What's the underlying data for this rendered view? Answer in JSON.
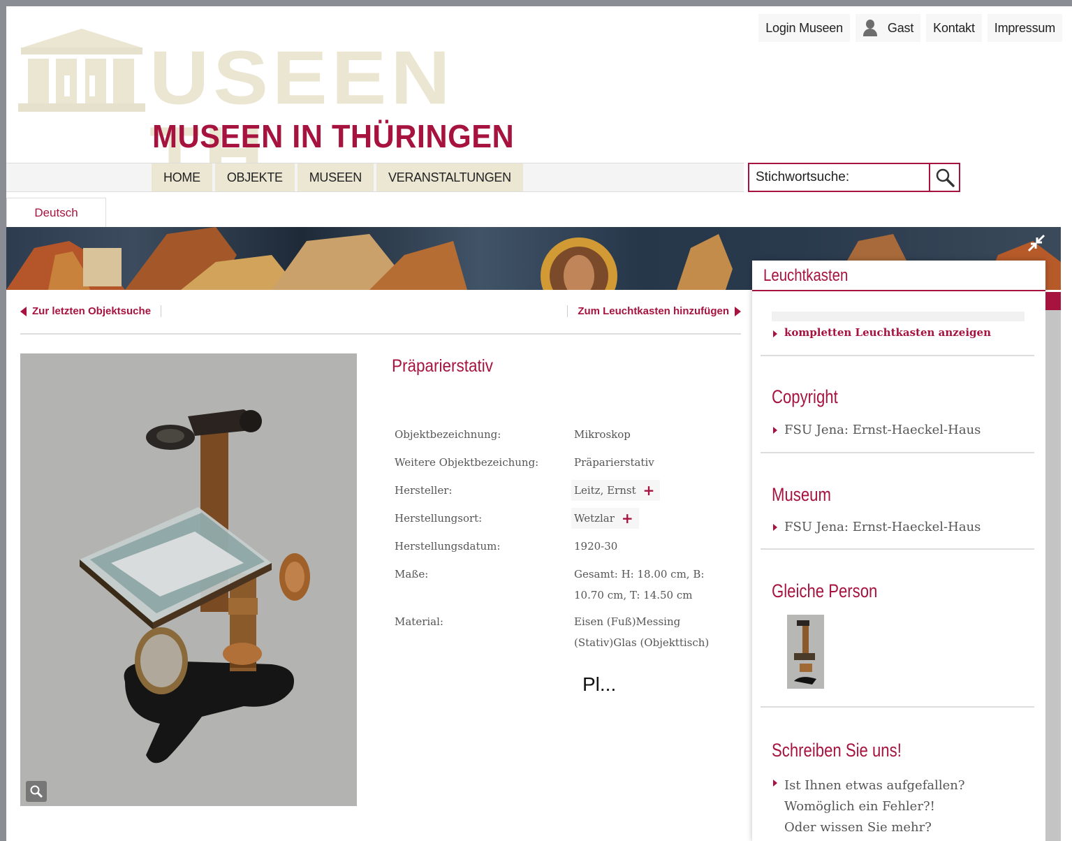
{
  "topnav": {
    "login": "Login Museen",
    "guest": "Gast",
    "contact": "Kontakt",
    "imprint": "Impressum"
  },
  "logo": {
    "big": "USEEN TH",
    "sub": "MUSEEN IN THÜRINGEN"
  },
  "nav": {
    "items": [
      "HOME",
      "OBJEKTE",
      "MUSEEN",
      "VERANSTALTUNGEN"
    ]
  },
  "search": {
    "placeholder": "Stichwortsuche:"
  },
  "lang": "Deutsch",
  "crumbs": {
    "back": "Zur letzten Objektsuche",
    "add": "Zum Leuchtkasten hinzufügen"
  },
  "object": {
    "title": "Präparierstativ",
    "fields": [
      {
        "label": "Objektbezeichnung:",
        "value": "Mikroskop"
      },
      {
        "label": "Weitere Objektbezeichung:",
        "value": "Präparierstativ"
      },
      {
        "label": "Hersteller:",
        "value": "Leitz, Ernst"
      },
      {
        "label": "Herstellungsort:",
        "value": "Wetzlar"
      },
      {
        "label": "Herstellungsdatum:",
        "value": "1920-30"
      },
      {
        "label": "Maße:",
        "value": "Gesamt: H: 18.00 cm, B: 10.70 cm, T: 14.50 cm"
      },
      {
        "label": "Material:",
        "value": "Eisen (Fuß)Messing (Stativ)Glas (Objekttisch)"
      }
    ],
    "truncated": "Pl..."
  },
  "sidebar": {
    "heading": "Leuchtkasten",
    "lightbox_link": "kompletten Leuchtkasten anzeigen",
    "copyright_h": "Copyright",
    "copyright_link": "FSU Jena: Ernst-Haeckel-Haus",
    "museum_h": "Museum",
    "museum_link": "FSU Jena: Ernst-Haeckel-Haus",
    "person_h": "Gleiche Person",
    "write_h": "Schreiben Sie uns!",
    "write_lines": [
      "Ist Ihnen etwas aufgefallen?",
      "Womöglich ein Fehler?!",
      "Oder wissen Sie mehr?"
    ]
  },
  "colors": {
    "accent": "#a6133f",
    "logo_beige": "#ebe6d2",
    "nav_bg": "#ece7d3"
  }
}
